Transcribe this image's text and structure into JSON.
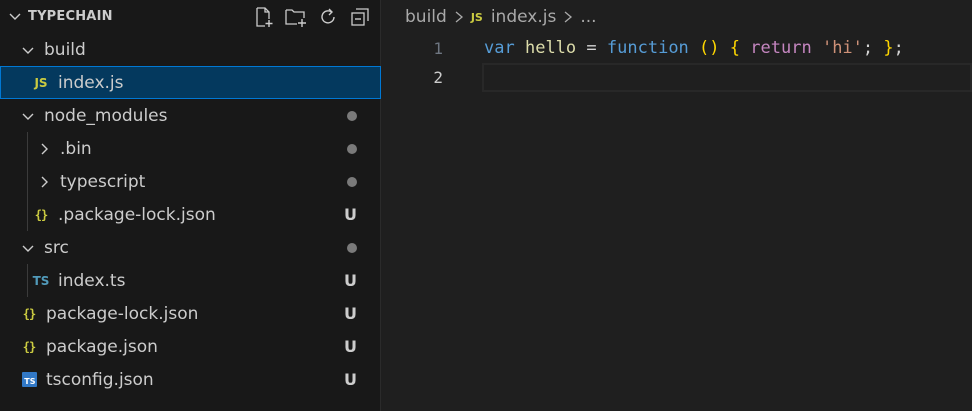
{
  "explorer": {
    "title": "TYPECHAIN",
    "actions": [
      "new-file-icon",
      "new-folder-icon",
      "refresh-icon",
      "collapse-all-icon"
    ],
    "items": [
      {
        "label": "build",
        "kind": "folder-open",
        "depth": 0,
        "decoration": ""
      },
      {
        "label": "index.js",
        "kind": "js",
        "depth": 1,
        "decoration": "",
        "selected": true
      },
      {
        "label": "node_modules",
        "kind": "folder-open",
        "depth": 0,
        "decoration": "dot"
      },
      {
        "label": ".bin",
        "kind": "folder-closed",
        "depth": 1,
        "decoration": "dot"
      },
      {
        "label": "typescript",
        "kind": "folder-closed",
        "depth": 1,
        "decoration": "dot"
      },
      {
        "label": ".package-lock.json",
        "kind": "json",
        "depth": 1,
        "decoration": "U"
      },
      {
        "label": "src",
        "kind": "folder-open",
        "depth": 0,
        "decoration": "dot"
      },
      {
        "label": "index.ts",
        "kind": "ts",
        "depth": 1,
        "decoration": "U"
      },
      {
        "label": "package-lock.json",
        "kind": "json",
        "depth": 0,
        "decoration": "U"
      },
      {
        "label": "package.json",
        "kind": "json",
        "depth": 0,
        "decoration": "U"
      },
      {
        "label": "tsconfig.json",
        "kind": "tsconfig",
        "depth": 0,
        "decoration": "U"
      }
    ]
  },
  "icons": {
    "js": "JS",
    "ts": "TS",
    "json": "{}",
    "tsconfig": "TS"
  },
  "editor": {
    "breadcrumbs": {
      "folder": "build",
      "file": "index.js",
      "more": "..."
    },
    "line_numbers": [
      "1",
      "2"
    ],
    "code_tokens": {
      "var_kw": "var",
      "name": "hello",
      "eq": "=",
      "function_kw": "function",
      "parens": "()",
      "open_brace": "{",
      "return_kw": "return",
      "string": "'hi'",
      "semi1": ";",
      "close_brace": "}",
      "semi2": ";"
    }
  },
  "colors": {
    "sidebar_bg": "#181818",
    "editor_bg": "#1f1f1f",
    "selection_bg": "#04395e",
    "selection_border": "#0078d4"
  }
}
